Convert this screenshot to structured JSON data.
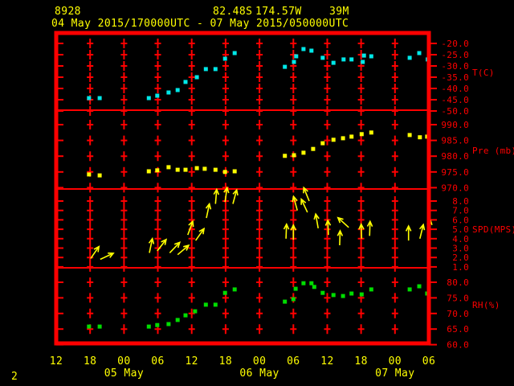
{
  "header": {
    "station_id": "8928",
    "latitude": "82.48S",
    "longitude": "174.57W",
    "elevation": "39M",
    "time_range": "04 May 2015/170000UTC - 07 May 2015/050000UTC"
  },
  "footer": {
    "page_number": "2"
  },
  "colors": {
    "background": "#000000",
    "frame": "#ff0000",
    "labels": "#ffff00",
    "temperature": "#00e8e8",
    "pressure": "#ffff00",
    "wind": "#ffff00",
    "humidity": "#00dd00"
  },
  "x_axis": {
    "tick_labels": [
      "12",
      "18",
      "00",
      "06",
      "12",
      "18",
      "00",
      "06",
      "12",
      "18",
      "00",
      "06"
    ],
    "hours_per_tick": 6,
    "day_labels": [
      {
        "text": "05 May",
        "tick_index": 2
      },
      {
        "text": "06 May",
        "tick_index": 6
      },
      {
        "text": "07 May",
        "tick_index": 10
      }
    ]
  },
  "chart_data": [
    {
      "type": "scatter",
      "name": "temperature",
      "ylabel": "T(C)",
      "color_key": "temperature",
      "yticks": [
        "-20.0",
        "-25.0",
        "-30.0",
        "-35.0",
        "-40.0",
        "-45.0",
        "-50.0"
      ],
      "x_unit": "hours since first x tick (12 UTC 04 May)",
      "points": [
        [
          5.8,
          -44.3
        ],
        [
          7.7,
          -44.3
        ],
        [
          16.4,
          -44.3
        ],
        [
          17.9,
          -43.2
        ],
        [
          19.9,
          -41.8
        ],
        [
          21.5,
          -40.7
        ],
        [
          22.9,
          -37.1
        ],
        [
          24.9,
          -35.0
        ],
        [
          26.5,
          -31.4
        ],
        [
          28.2,
          -31.4
        ],
        [
          29.9,
          -26.8
        ],
        [
          31.6,
          -24.3
        ],
        [
          40.5,
          -30.4
        ],
        [
          42.1,
          -28.2
        ],
        [
          42.5,
          -25.7
        ],
        [
          43.8,
          -22.5
        ],
        [
          45.2,
          -23.2
        ],
        [
          47.2,
          -26.4
        ],
        [
          49.1,
          -28.6
        ],
        [
          50.9,
          -27.1
        ],
        [
          52.3,
          -27.1
        ],
        [
          54.3,
          -28.2
        ],
        [
          54.5,
          -25.4
        ],
        [
          55.8,
          -25.7
        ],
        [
          62.6,
          -26.4
        ],
        [
          64.3,
          -24.3
        ],
        [
          65.8,
          -27.1
        ]
      ]
    },
    {
      "type": "scatter",
      "name": "pressure",
      "ylabel": "Pre (mb)",
      "color_key": "pressure",
      "yticks": [
        "990.0",
        "985.0",
        "980.0",
        "975.0",
        "970.0"
      ],
      "x_unit": "hours since first x tick (12 UTC 04 May)",
      "points": [
        [
          5.8,
          974.2
        ],
        [
          7.7,
          973.9
        ],
        [
          16.4,
          975.2
        ],
        [
          17.9,
          975.5
        ],
        [
          19.9,
          976.5
        ],
        [
          21.5,
          975.7
        ],
        [
          22.9,
          975.7
        ],
        [
          24.9,
          976.2
        ],
        [
          26.3,
          976.0
        ],
        [
          28.2,
          975.7
        ],
        [
          29.9,
          975.0
        ],
        [
          31.6,
          975.2
        ],
        [
          40.5,
          980.1
        ],
        [
          42.1,
          980.3
        ],
        [
          43.8,
          981.1
        ],
        [
          45.5,
          982.3
        ],
        [
          47.2,
          984.1
        ],
        [
          49.1,
          985.2
        ],
        [
          50.8,
          985.7
        ],
        [
          52.3,
          986.2
        ],
        [
          54.1,
          987.0
        ],
        [
          55.8,
          987.5
        ],
        [
          62.6,
          986.7
        ],
        [
          64.4,
          986.0
        ],
        [
          65.7,
          986.2
        ]
      ]
    },
    {
      "type": "wind-arrow",
      "name": "wind_speed",
      "ylabel": "SPD(MPS)",
      "color_key": "wind",
      "yticks": [
        "8.0",
        "7.0",
        "6.0",
        "5.0",
        "4.0",
        "3.0",
        "2.0",
        "1.0"
      ],
      "x_unit": "hours since first x tick (12 UTC 04 May)",
      "angle_convention": "degrees counterclockwise from screen-right",
      "points": [
        [
          6.1,
          1.9,
          55
        ],
        [
          7.8,
          1.8,
          25
        ],
        [
          16.5,
          2.5,
          78
        ],
        [
          17.9,
          2.7,
          52
        ],
        [
          20.1,
          2.5,
          46
        ],
        [
          21.5,
          2.3,
          40
        ],
        [
          23.3,
          4.4,
          70
        ],
        [
          24.7,
          3.8,
          55
        ],
        [
          26.6,
          6.2,
          78
        ],
        [
          28.2,
          7.7,
          85
        ],
        [
          29.9,
          7.9,
          82
        ],
        [
          31.3,
          7.7,
          75
        ],
        [
          40.7,
          4.0,
          88
        ],
        [
          42.0,
          3.9,
          90
        ],
        [
          42.7,
          7.0,
          105
        ],
        [
          44.5,
          6.8,
          115
        ],
        [
          44.8,
          8.0,
          112
        ],
        [
          46.4,
          5.1,
          100
        ],
        [
          48.2,
          4.4,
          92
        ],
        [
          50.2,
          3.3,
          88
        ],
        [
          51.8,
          5.2,
          138
        ],
        [
          54.1,
          4.0,
          92
        ],
        [
          55.5,
          4.3,
          88
        ],
        [
          62.4,
          3.8,
          90
        ],
        [
          64.4,
          4.0,
          76
        ],
        [
          65.9,
          4.5,
          82
        ]
      ]
    },
    {
      "type": "scatter",
      "name": "humidity",
      "ylabel": "RH(%)",
      "color_key": "humidity",
      "yticks": [
        "80.0",
        "75.0",
        "70.0",
        "65.0",
        "60.0"
      ],
      "x_unit": "hours since first x tick (12 UTC 04 May)",
      "points": [
        [
          5.8,
          65.8
        ],
        [
          7.7,
          65.8
        ],
        [
          16.4,
          65.8
        ],
        [
          17.9,
          66.3
        ],
        [
          19.9,
          66.6
        ],
        [
          21.5,
          67.9
        ],
        [
          22.9,
          69.4
        ],
        [
          24.6,
          70.7
        ],
        [
          26.5,
          72.8
        ],
        [
          28.2,
          72.8
        ],
        [
          29.9,
          76.6
        ],
        [
          31.6,
          77.7
        ],
        [
          40.5,
          73.8
        ],
        [
          42.0,
          74.6
        ],
        [
          42.4,
          77.9
        ],
        [
          43.8,
          79.7
        ],
        [
          45.2,
          79.7
        ],
        [
          45.7,
          78.5
        ],
        [
          47.2,
          76.6
        ],
        [
          49.1,
          75.9
        ],
        [
          50.8,
          75.6
        ],
        [
          52.3,
          76.4
        ],
        [
          54.1,
          76.1
        ],
        [
          55.8,
          77.7
        ],
        [
          62.6,
          77.7
        ],
        [
          64.3,
          78.7
        ],
        [
          65.7,
          76.4
        ]
      ]
    }
  ]
}
